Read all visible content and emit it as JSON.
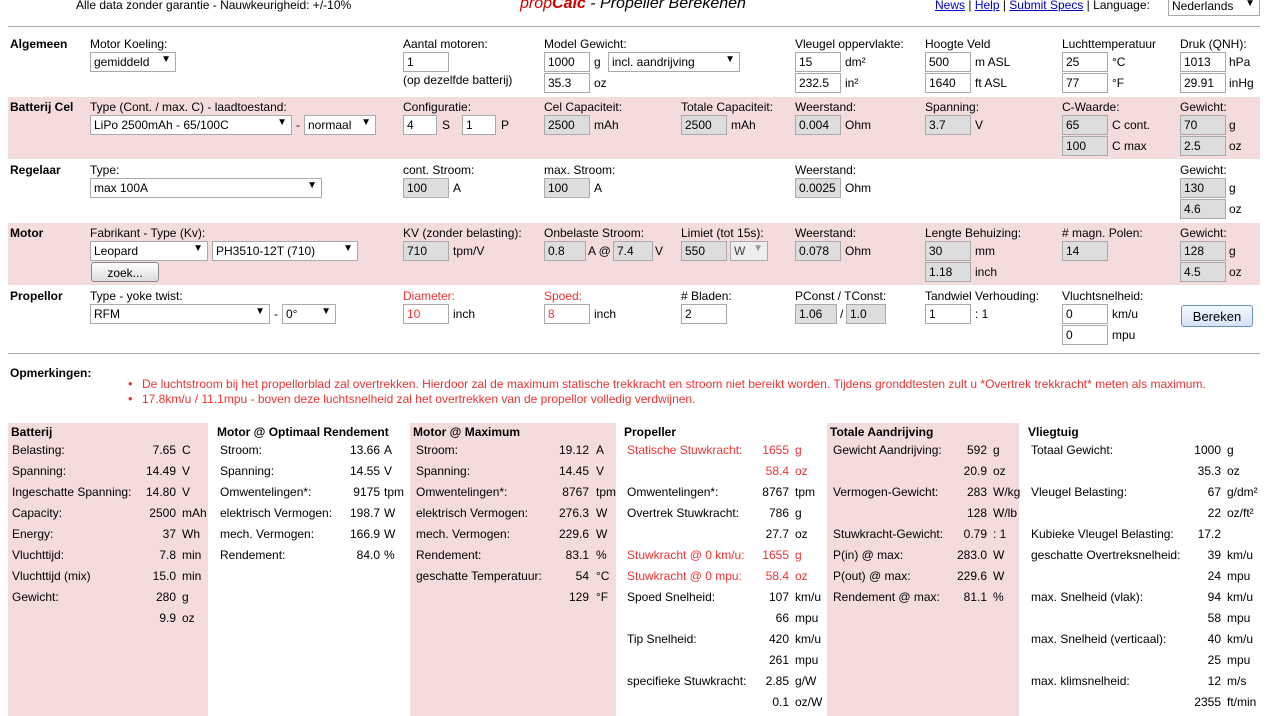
{
  "header": {
    "disclaimer": "Alle data zonder garantie - Nauwkeurigheid: +/-10%",
    "logo_prop": "prop",
    "logo_calc": "Calc",
    "title": " - Propeller Berekenen",
    "nav_news": "News",
    "nav_help": "Help",
    "nav_submit": "Submit Specs",
    "language_label": "Language:",
    "language_value": "Nederlands"
  },
  "general": {
    "section": "Algemeen",
    "cooling_label": "Motor Koeling:",
    "cooling_value": "gemiddeld",
    "motors_label": "Aantal motoren:",
    "motors_value": "1",
    "motors_note": "(op dezelfde batterij)",
    "weight_label": "Model Gewicht:",
    "weight_g": "1000",
    "weight_unit_g": "g",
    "weight_mode": "incl. aandrijving",
    "weight_oz": "35.3",
    "weight_unit_oz": "oz",
    "wing_label": "Vleugel oppervlakte:",
    "wing_dm": "15",
    "wing_unit_dm": "dm²",
    "wing_in": "232.5",
    "wing_unit_in": "in²",
    "alt_label": "Hoogte Veld",
    "alt_m": "500",
    "alt_unit_m": "m ASL",
    "alt_ft": "1640",
    "alt_unit_ft": "ft ASL",
    "temp_label": "Luchttemperatuur",
    "temp_c": "25",
    "temp_unit_c": "°C",
    "temp_f": "77",
    "temp_unit_f": "°F",
    "qnh_label": "Druk (QNH):",
    "qnh_hpa": "1013",
    "qnh_unit_hpa": "hPa",
    "qnh_inhg": "29.91",
    "qnh_unit_inhg": "inHg"
  },
  "battery": {
    "section": "Batterij Cel",
    "type_label": "Type (Cont. / max. C) - laadtoestand:",
    "type_value": "LiPo 2500mAh - 65/100C",
    "dash": "-",
    "state_value": "normaal",
    "config_label": "Configuratie:",
    "config_s": "4",
    "s": "S",
    "config_p": "1",
    "p": "P",
    "cell_cap_label": "Cel Capaciteit:",
    "cell_cap": "2500",
    "mah": "mAh",
    "total_cap_label": "Totale Capaciteit:",
    "total_cap": "2500",
    "mah2": "mAh",
    "res_label": "Weerstand:",
    "res": "0.004",
    "ohm": "Ohm",
    "volt_label": "Spanning:",
    "volt": "3.7",
    "v": "V",
    "c_label": "C-Waarde:",
    "c_cont": "65",
    "c_cont_unit": "C cont.",
    "c_max": "100",
    "c_max_unit": "C max",
    "weight_label": "Gewicht:",
    "weight_g": "70",
    "g": "g",
    "weight_oz": "2.5",
    "oz": "oz"
  },
  "esc": {
    "section": "Regelaar",
    "type_label": "Type:",
    "type_value": "max 100A",
    "cont_label": "cont. Stroom:",
    "cont": "100",
    "a1": "A",
    "max_label": "max. Stroom:",
    "max": "100",
    "a2": "A",
    "res_label": "Weerstand:",
    "res": "0.0025",
    "ohm": "Ohm",
    "weight_label": "Gewicht:",
    "weight_g": "130",
    "g": "g",
    "weight_oz": "4.6",
    "oz": "oz"
  },
  "motor": {
    "section": "Motor",
    "type_label": "Fabrikant - Type (Kv):",
    "maker": "Leopard",
    "model": "PH3510-12T (710)",
    "search": "zoek...",
    "kv_label": "KV (zonder belasting):",
    "kv": "710",
    "kv_unit": "tpm/V",
    "idle_label": "Onbelaste Stroom:",
    "idle_a": "0.8",
    "idle_at": "A @",
    "idle_v": "7.4",
    "v": "V",
    "limit_label": "Limiet (tot 15s):",
    "limit": "550",
    "limit_unit": "W",
    "res_label": "Weerstand:",
    "res": "0.078",
    "ohm": "Ohm",
    "len_label": "Lengte Behuizing:",
    "len_mm": "30",
    "mm": "mm",
    "len_in": "1.18",
    "inch": "inch",
    "poles_label": "# magn. Polen:",
    "poles": "14",
    "weight_label": "Gewicht:",
    "weight_g": "128",
    "g": "g",
    "weight_oz": "4.5",
    "oz": "oz"
  },
  "prop": {
    "section": "Propellor",
    "type_label": "Type - yoke twist:",
    "type_value": "RFM",
    "dash": "-",
    "twist": "0°",
    "dia_label": "Diameter:",
    "dia": "10",
    "inch1": "inch",
    "pitch_label": "Spoed:",
    "pitch": "8",
    "inch2": "inch",
    "blades_label": "# Bladen:",
    "blades": "2",
    "pconst_label": "PConst / TConst:",
    "pconst": "1.06",
    "slash": "/",
    "tconst": "1.0",
    "gear_label": "Tandwiel Verhouding:",
    "gear": "1",
    "gear_ratio": ": 1",
    "speed_label": "Vluchtsnelheid:",
    "speed_kmh": "0",
    "kmh": "km/u",
    "speed_mph": "0",
    "mpu": "mpu",
    "calc_button": "Bereken"
  },
  "remarks": {
    "label": "Opmerkingen:",
    "items": [
      "De luchtstroom bij het propellorblad zal overtrekken. Hierdoor zal de maximum statische trekkracht en stroom niet bereikt worden. Tijdens gronddtesten zult u *Overtrek trekkracht* meten als maximum.",
      "17.8km/u / 11.1mpu - boven deze luchtsnelheid zal het overtrekken van de propellor volledig verdwijnen."
    ]
  },
  "results": {
    "battery": {
      "title": "Batterij",
      "rows": [
        [
          "Belasting:",
          "7.65",
          "C"
        ],
        [
          "Spanning:",
          "14.49",
          "V"
        ],
        [
          "Ingeschatte Spanning:",
          "14.80",
          "V"
        ],
        [
          "Capacity:",
          "2500",
          "mAh"
        ],
        [
          "Energy:",
          "37",
          "Wh"
        ],
        [
          "Vluchttijd:",
          "7.8",
          "min"
        ],
        [
          "Vluchttijd (mix)",
          "15.0",
          "min"
        ],
        [
          "Gewicht:",
          "280",
          "g"
        ],
        [
          "",
          "9.9",
          "oz"
        ]
      ]
    },
    "motor_opt": {
      "title": "Motor @ Optimaal Rendement",
      "rows": [
        [
          "Stroom:",
          "13.66",
          "A"
        ],
        [
          "Spanning:",
          "14.55",
          "V"
        ],
        [
          "Omwentelingen*:",
          "9175",
          "tpm"
        ],
        [
          "elektrisch Vermogen:",
          "198.7",
          "W"
        ],
        [
          "mech. Vermogen:",
          "166.9",
          "W"
        ],
        [
          "Rendement:",
          "84.0",
          "%"
        ]
      ]
    },
    "motor_max": {
      "title": "Motor @ Maximum",
      "rows": [
        [
          "Stroom:",
          "19.12",
          "A"
        ],
        [
          "Spanning:",
          "14.45",
          "V"
        ],
        [
          "Omwentelingen*:",
          "8767",
          "tpm"
        ],
        [
          "elektrisch Vermogen:",
          "276.3",
          "W"
        ],
        [
          "mech. Vermogen:",
          "229.6",
          "W"
        ],
        [
          "Rendement:",
          "83.1",
          "%"
        ],
        [
          "geschatte Temperatuur:",
          "54",
          "°C"
        ],
        [
          "",
          "129",
          "°F"
        ]
      ]
    },
    "propeller": {
      "title": "Propeller",
      "rows": [
        [
          "Statische Stuwkracht:",
          "1655",
          "g"
        ],
        [
          "",
          "58.4",
          "oz"
        ],
        [
          "Omwentelingen*:",
          "8767",
          "tpm"
        ],
        [
          "Overtrek Stuwkracht:",
          "786",
          "g"
        ],
        [
          "",
          "27.7",
          "oz"
        ],
        [
          "Stuwkracht @ 0 km/u:",
          "1655",
          "g"
        ],
        [
          "Stuwkracht @ 0 mpu:",
          "58.4",
          "oz"
        ],
        [
          "Spoed Snelheid:",
          "107",
          "km/u"
        ],
        [
          "",
          "66",
          "mpu"
        ],
        [
          "Tip Snelheid:",
          "420",
          "km/u"
        ],
        [
          "",
          "261",
          "mpu"
        ],
        [
          "specifieke Stuwkracht:",
          "2.85",
          "g/W"
        ],
        [
          "",
          "0.1",
          "oz/W"
        ]
      ]
    },
    "drive": {
      "title": "Totale Aandrijving",
      "rows": [
        [
          "Gewicht Aandrijving:",
          "592",
          "g"
        ],
        [
          "",
          "20.9",
          "oz"
        ],
        [
          "Vermogen-Gewicht:",
          "283",
          "W/kg"
        ],
        [
          "",
          "128",
          "W/lb"
        ],
        [
          "Stuwkracht-Gewicht:",
          "0.79",
          ": 1"
        ],
        [
          "P(in) @ max:",
          "283.0",
          "W"
        ],
        [
          "P(out) @ max:",
          "229.6",
          "W"
        ],
        [
          "Rendement @ max:",
          "81.1",
          "%"
        ]
      ]
    },
    "plane": {
      "title": "Vliegtuig",
      "rows": [
        [
          "Totaal Gewicht:",
          "1000",
          "g"
        ],
        [
          "",
          "35.3",
          "oz"
        ],
        [
          "Vleugel Belasting:",
          "67",
          "g/dm²"
        ],
        [
          "",
          "22",
          "oz/ft²"
        ],
        [
          "Kubieke Vleugel Belasting:",
          "17.2",
          ""
        ],
        [
          "geschatte Overtreksnelheid:",
          "39",
          "km/u"
        ],
        [
          "",
          "24",
          "mpu"
        ],
        [
          "max. Snelheid (vlak):",
          "94",
          "km/u"
        ],
        [
          "",
          "58",
          "mpu"
        ],
        [
          "max. Snelheid (verticaal):",
          "40",
          "km/u"
        ],
        [
          "",
          "25",
          "mpu"
        ],
        [
          "max. klimsnelheid:",
          "12",
          "m/s"
        ],
        [
          "",
          "2355",
          "ft/min"
        ]
      ]
    }
  },
  "colors": {
    "band": "#f5dcdc",
    "warning": "#e33",
    "link": "#00c"
  }
}
